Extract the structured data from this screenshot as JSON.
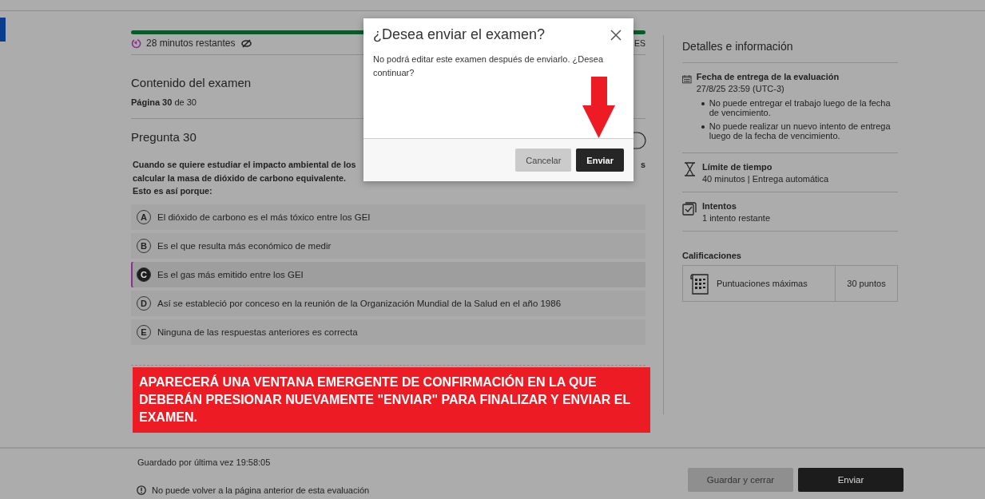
{
  "timer": {
    "text": "28 minutos restantes",
    "level": 1,
    "right_fragment": "ES"
  },
  "content": {
    "heading": "Contenido del examen",
    "page": "**Página 30** de 30"
  },
  "question": {
    "title": "Pregunta 30",
    "lines": [
      "Cuando se quiere estudiar el impacto ambiental de los",
      "calcular la masa de dióxido de carbono equivalente.",
      "Esto es así porque:"
    ],
    "line_end_fragment": "s",
    "options": [
      {
        "letter": "A",
        "text": "El dióxido de carbono es el más tóxico entre los GEI",
        "selected": false
      },
      {
        "letter": "B",
        "text": "Es el que resulta más económico de medir",
        "selected": false
      },
      {
        "letter": "C",
        "text": "Es el gas más emitido entre los GEI",
        "selected": true
      },
      {
        "letter": "D",
        "text": "Así se estableció por conceso en la reunión de la Organización Mundial de la Salud en el año 1986",
        "selected": false
      },
      {
        "letter": "E",
        "text": "Ninguna de las respuestas anteriores es correcta",
        "selected": false
      }
    ]
  },
  "annotation": {
    "banner": "APARECERÁ UNA VENTANA EMERGENTE DE CONFIRMACIÓN EN LA QUE DEBERÁN PRESIONAR NUEVAMENTE \"ENVIAR\" PARA FINALIZAR Y ENVIAR EL EXAMEN."
  },
  "details": {
    "title": "Detalles e información",
    "sections": [
      {
        "kind": "calendar",
        "title": "Fecha de entrega de la evaluación",
        "value": "27/8/25 23:59 (UTC-3)",
        "bullets": [
          "No puede entregar el trabajo luego de la fecha de vencimiento.",
          "No puede realizar un nuevo intento de entrega luego de la fecha de vencimiento."
        ]
      },
      {
        "kind": "hourglass",
        "title": "Límite de tiempo",
        "value": "40 minutos | Entrega automática"
      },
      {
        "kind": "attempts",
        "title": "Intentos",
        "value": "1 intento restante"
      }
    ],
    "grades_title": "Calificaciones",
    "grade": {
      "label": "Puntuaciones máximas",
      "value": "30 puntos"
    }
  },
  "footer": {
    "saved": "Guardado por última vez 19:58:05",
    "warning": "No puede volver a la página anterior de esta evaluación",
    "buttons": [
      {
        "label": "Guardar y cerrar",
        "kind": "secondary"
      },
      {
        "label": "Enviar",
        "kind": "primary"
      }
    ]
  },
  "dialog": {
    "title": "¿Desea enviar el examen?",
    "message": "No podrá editar este examen después de enviarlo. ¿Desea continuar?",
    "buttons": [
      {
        "label": "Cancelar",
        "kind": "secondary"
      },
      {
        "label": "Enviar",
        "kind": "primary"
      }
    ]
  }
}
